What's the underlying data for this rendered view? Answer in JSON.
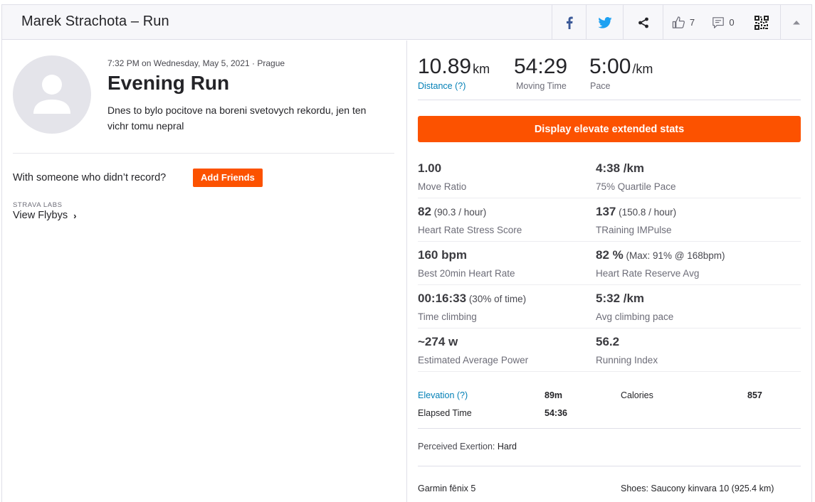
{
  "header": {
    "title": "Marek Strachota – Run",
    "kudos_count": "7",
    "comments_count": "0"
  },
  "activity": {
    "date_line": "7:32 PM on Wednesday, May 5, 2021 · Prague",
    "name": "Evening Run",
    "description": "Dnes to bylo pocitove na boreni svetovych rekordu, jen ten vichr tomu nepral"
  },
  "left": {
    "with_someone": "With someone who didn’t record?",
    "add_friends": "Add Friends",
    "labs_label": "STRAVA LABS",
    "flybys": "View Flybys",
    "flybys_chevron": "›"
  },
  "stats": {
    "distance": {
      "value": "10.89",
      "unit": "km",
      "label": "Distance (?)"
    },
    "moving_time": {
      "value": "54:29",
      "label": "Moving Time"
    },
    "pace": {
      "value": "5:00",
      "unit": "/km",
      "label": "Pace"
    }
  },
  "elevate_button": "Display elevate extended stats",
  "extended": [
    {
      "left": {
        "value": "1.00",
        "sub": "",
        "label": "Move Ratio"
      },
      "right": {
        "value": "4:38 /km",
        "sub": "",
        "label": "75% Quartile Pace"
      }
    },
    {
      "left": {
        "value": "82",
        "sub": " (90.3 / hour)",
        "label": "Heart Rate Stress Score"
      },
      "right": {
        "value": "137",
        "sub": " (150.8 / hour)",
        "label": "TRaining IMPulse"
      }
    },
    {
      "left": {
        "value": "160 bpm",
        "sub": "",
        "label": "Best 20min Heart Rate"
      },
      "right": {
        "value": "82 %",
        "sub": " (Max: 91% @ 168bpm)",
        "label": "Heart Rate Reserve Avg"
      }
    },
    {
      "left": {
        "value": "00:16:33",
        "sub": " (30% of time)",
        "label": "Time climbing"
      },
      "right": {
        "value": "5:32 /km",
        "sub": "",
        "label": "Avg climbing pace"
      }
    },
    {
      "left": {
        "value": "~274 w",
        "sub": "",
        "label": "Estimated Average Power"
      },
      "right": {
        "value": "56.2",
        "sub": "",
        "label": "Running Index"
      }
    }
  ],
  "more_stats": {
    "elevation_label": "Elevation (?)",
    "elevation_value": "89m",
    "calories_label": "Calories",
    "calories_value": "857",
    "elapsed_label": "Elapsed Time",
    "elapsed_value": "54:36"
  },
  "perceived": {
    "label": "Perceived Exertion:",
    "value": "Hard"
  },
  "gear": {
    "device": "Garmin fēnix 5",
    "shoes": "Shoes: Saucony kinvara 10 (925.4 km)"
  },
  "colors": {
    "accent": "#fc5200",
    "link": "#007fb6",
    "facebook": "#3b5998",
    "twitter": "#1da1f2"
  },
  "icons": [
    "facebook-icon",
    "twitter-icon",
    "share-icon",
    "thumbs-up-icon",
    "comment-icon",
    "qr-code-icon",
    "chevron-up-icon",
    "avatar-silhouette-icon"
  ]
}
